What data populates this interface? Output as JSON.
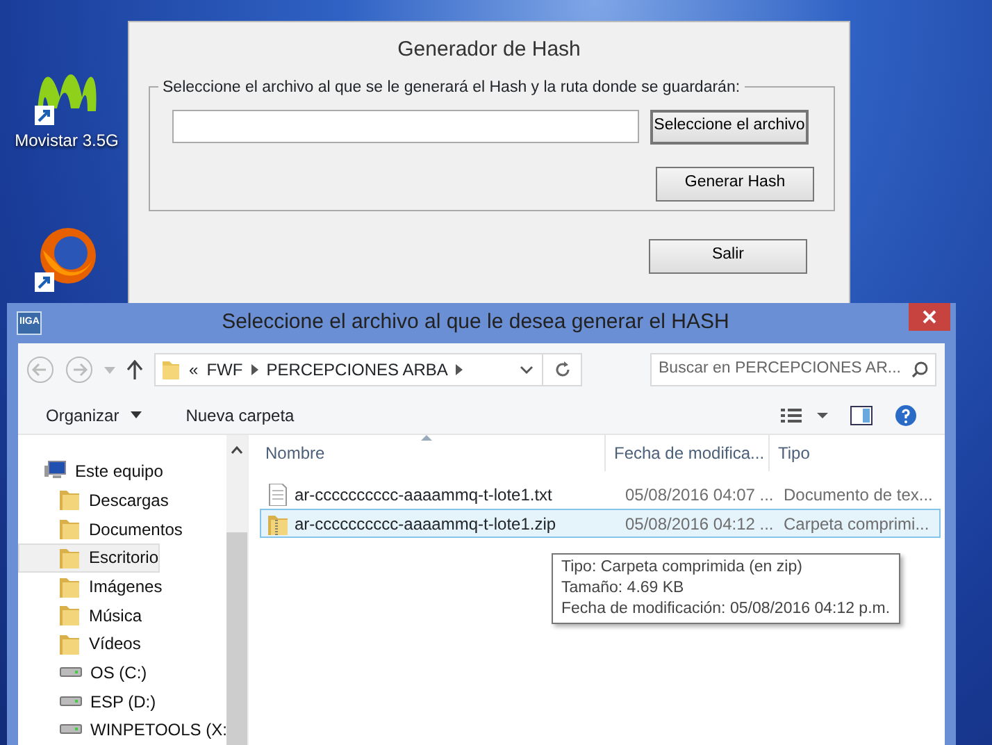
{
  "desktop_icons": [
    {
      "kind": "movistar",
      "label": "Movistar 3.5G"
    },
    {
      "kind": "firefox"
    }
  ],
  "hash_window": {
    "title": "Generador de Hash",
    "group_label": "Seleccione el archivo al que se le generará el Hash y la ruta donde se guardarán:",
    "buttons": [
      "Seleccione el archivo",
      "Generar Hash",
      "Salir"
    ]
  },
  "file_dialog": {
    "title": "Seleccione el archivo al que le desea generar el HASH",
    "app_icon": "IIGA",
    "breadcrumb": {
      "overflow": "«",
      "path": [
        "FWF",
        "PERCEPCIONES ARBA"
      ]
    },
    "search": {
      "placeholder": "Buscar en PERCEPCIONES AR..."
    },
    "toolbar": [
      "Organizar",
      "Nueva carpeta"
    ],
    "nav_tree": [
      {
        "label": "Este equipo",
        "kind": "computer",
        "selected": false,
        "children": [
          {
            "label": "Descargas",
            "kind": "folder",
            "selected": false
          },
          {
            "label": "Documentos",
            "kind": "folder",
            "selected": false
          },
          {
            "label": "Escritorio",
            "kind": "folder",
            "selected": true
          },
          {
            "label": "Imágenes",
            "kind": "folder",
            "selected": false
          },
          {
            "label": "Música",
            "kind": "folder",
            "selected": false
          },
          {
            "label": "Vídeos",
            "kind": "folder",
            "selected": false
          },
          {
            "label": "OS (C:)",
            "kind": "drive",
            "selected": false
          },
          {
            "label": "ESP (D:)",
            "kind": "drive",
            "selected": false
          },
          {
            "label": "WINPETOOLS (X:",
            "kind": "drive",
            "selected": false
          }
        ]
      }
    ],
    "columns": [
      "Nombre",
      "Fecha de modifica...",
      "Tipo"
    ],
    "files": [
      {
        "kind": "text",
        "name": "ar-cccccccccc-aaaammq-t-lote1.txt",
        "date": "05/08/2016 04:07 ...",
        "type": "Documento de tex...",
        "selected": false
      },
      {
        "kind": "zip",
        "name": "ar-cccccccccc-aaaammq-t-lote1.zip",
        "date": "05/08/2016 04:12 ...",
        "type": "Carpeta comprimi...",
        "selected": true
      }
    ],
    "tooltip": [
      "Tipo: Carpeta comprimida (en zip)",
      "Tamaño: 4.69 KB",
      "Fecha de modificación: 05/08/2016 04:12 p.m."
    ]
  }
}
